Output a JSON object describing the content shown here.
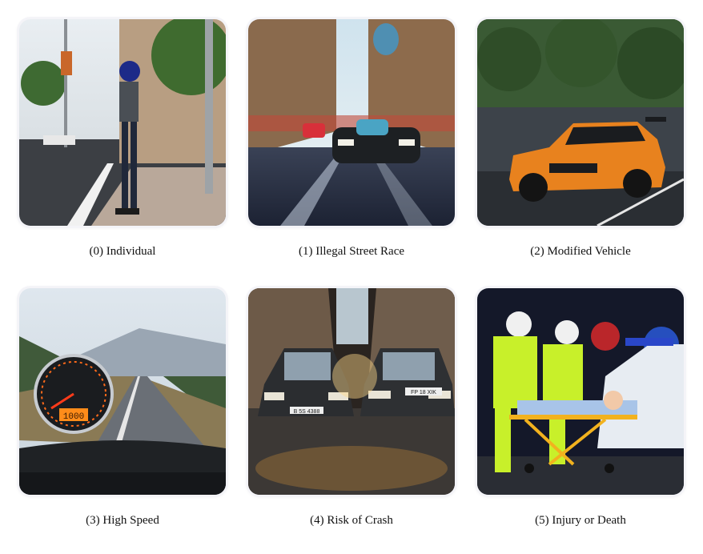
{
  "panels": [
    {
      "caption": "(0) Individual",
      "icon": "person-at-curb-illustration"
    },
    {
      "caption": "(1) Illegal Street Race",
      "icon": "race-car-city-street-illustration"
    },
    {
      "caption": "(2) Modified Vehicle",
      "icon": "orange-sports-car-illustration"
    },
    {
      "caption": "(3) High Speed",
      "icon": "speedometer-road-illustration",
      "speedometer_readout": "1000"
    },
    {
      "caption": "(4) Risk of Crash",
      "icon": "two-cars-collision-illustration",
      "plates": [
        "B 5S 4388",
        "FP 18 XIK"
      ]
    },
    {
      "caption": "(5) Injury or Death",
      "icon": "paramedics-stretcher-illustration"
    }
  ]
}
